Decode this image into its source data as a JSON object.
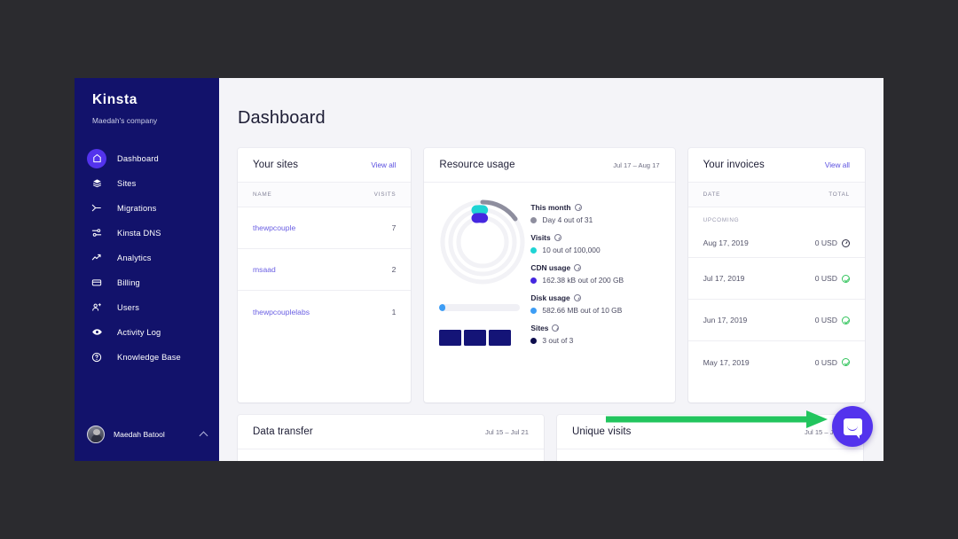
{
  "sidebar": {
    "logo": "Kinsta",
    "company": "Maedah's company",
    "items": [
      {
        "label": "Dashboard",
        "icon": "home-icon",
        "active": true
      },
      {
        "label": "Sites",
        "icon": "layers-icon",
        "active": false
      },
      {
        "label": "Migrations",
        "icon": "migration-icon",
        "active": false
      },
      {
        "label": "Kinsta DNS",
        "icon": "dns-sliders-icon",
        "active": false
      },
      {
        "label": "Analytics",
        "icon": "trend-up-icon",
        "active": false
      },
      {
        "label": "Billing",
        "icon": "credit-card-icon",
        "active": false
      },
      {
        "label": "Users",
        "icon": "user-plus-icon",
        "active": false
      },
      {
        "label": "Activity Log",
        "icon": "eye-icon",
        "active": false
      },
      {
        "label": "Knowledge Base",
        "icon": "question-circle-icon",
        "active": false
      }
    ],
    "user": {
      "name": "Maedah Batool",
      "chevron": "chevron-up-icon"
    }
  },
  "page": {
    "title": "Dashboard"
  },
  "your_sites": {
    "title": "Your sites",
    "view_all": "View all",
    "columns": [
      "NAME",
      "VISITS"
    ],
    "rows": [
      {
        "name": "thewpcouple",
        "visits": "7"
      },
      {
        "name": "msaad",
        "visits": "2"
      },
      {
        "name": "thewpcouplelabs",
        "visits": "1"
      }
    ]
  },
  "resource_usage": {
    "title": "Resource usage",
    "date_range": "Jul 17 – Aug 17",
    "metrics": [
      {
        "label": "This month",
        "value": "Day 4 out of 31",
        "color": "#8e8e9e"
      },
      {
        "label": "Visits",
        "value": "10 out of 100,000",
        "color": "#1fd4d4"
      },
      {
        "label": "CDN usage",
        "value": "162.38 kB out of 200 GB",
        "color": "#4527e0"
      },
      {
        "label": "Disk usage",
        "value": "582.66 MB out of 10 GB",
        "color": "#3d9df5"
      },
      {
        "label": "Sites",
        "value": "3 out of 3",
        "color": "#0d0d4d"
      }
    ],
    "donut": {
      "ring_color": "#f1f1f5",
      "arc_color": "#8e8e9e",
      "dot_cyan": "#1fd4d4",
      "dot_purple": "#4527e0"
    },
    "progress": {
      "fill_color": "#3d9df5",
      "percent": 6
    },
    "site_squares": {
      "count": 3,
      "color": "#141477"
    }
  },
  "your_invoices": {
    "title": "Your invoices",
    "view_all": "View all",
    "columns": [
      "DATE",
      "TOTAL"
    ],
    "upcoming_tag": "UPCOMING",
    "rows": [
      {
        "date": "Aug 17, 2019",
        "total": "0 USD",
        "status": "pending"
      },
      {
        "date": "Jul 17, 2019",
        "total": "0 USD",
        "status": "paid"
      },
      {
        "date": "Jun 17, 2019",
        "total": "0 USD",
        "status": "paid"
      },
      {
        "date": "May 17, 2019",
        "total": "0 USD",
        "status": "paid"
      }
    ]
  },
  "data_transfer": {
    "title": "Data transfer",
    "date_range": "Jul 15 – Jul 21"
  },
  "unique_visits": {
    "title": "Unique visits",
    "date_range": "Jul 15 – Jul 21"
  },
  "intercom": {
    "label": "intercom-chat-button",
    "color": "#5333ed"
  },
  "annotation": {
    "type": "arrow",
    "color": "#22c55e",
    "points_to": "intercom-chat-button"
  },
  "colors": {
    "sidebar_bg": "#12126b",
    "accent": "#5333ed",
    "page_bg": "#f4f4f8",
    "link": "#5a4fe0"
  }
}
